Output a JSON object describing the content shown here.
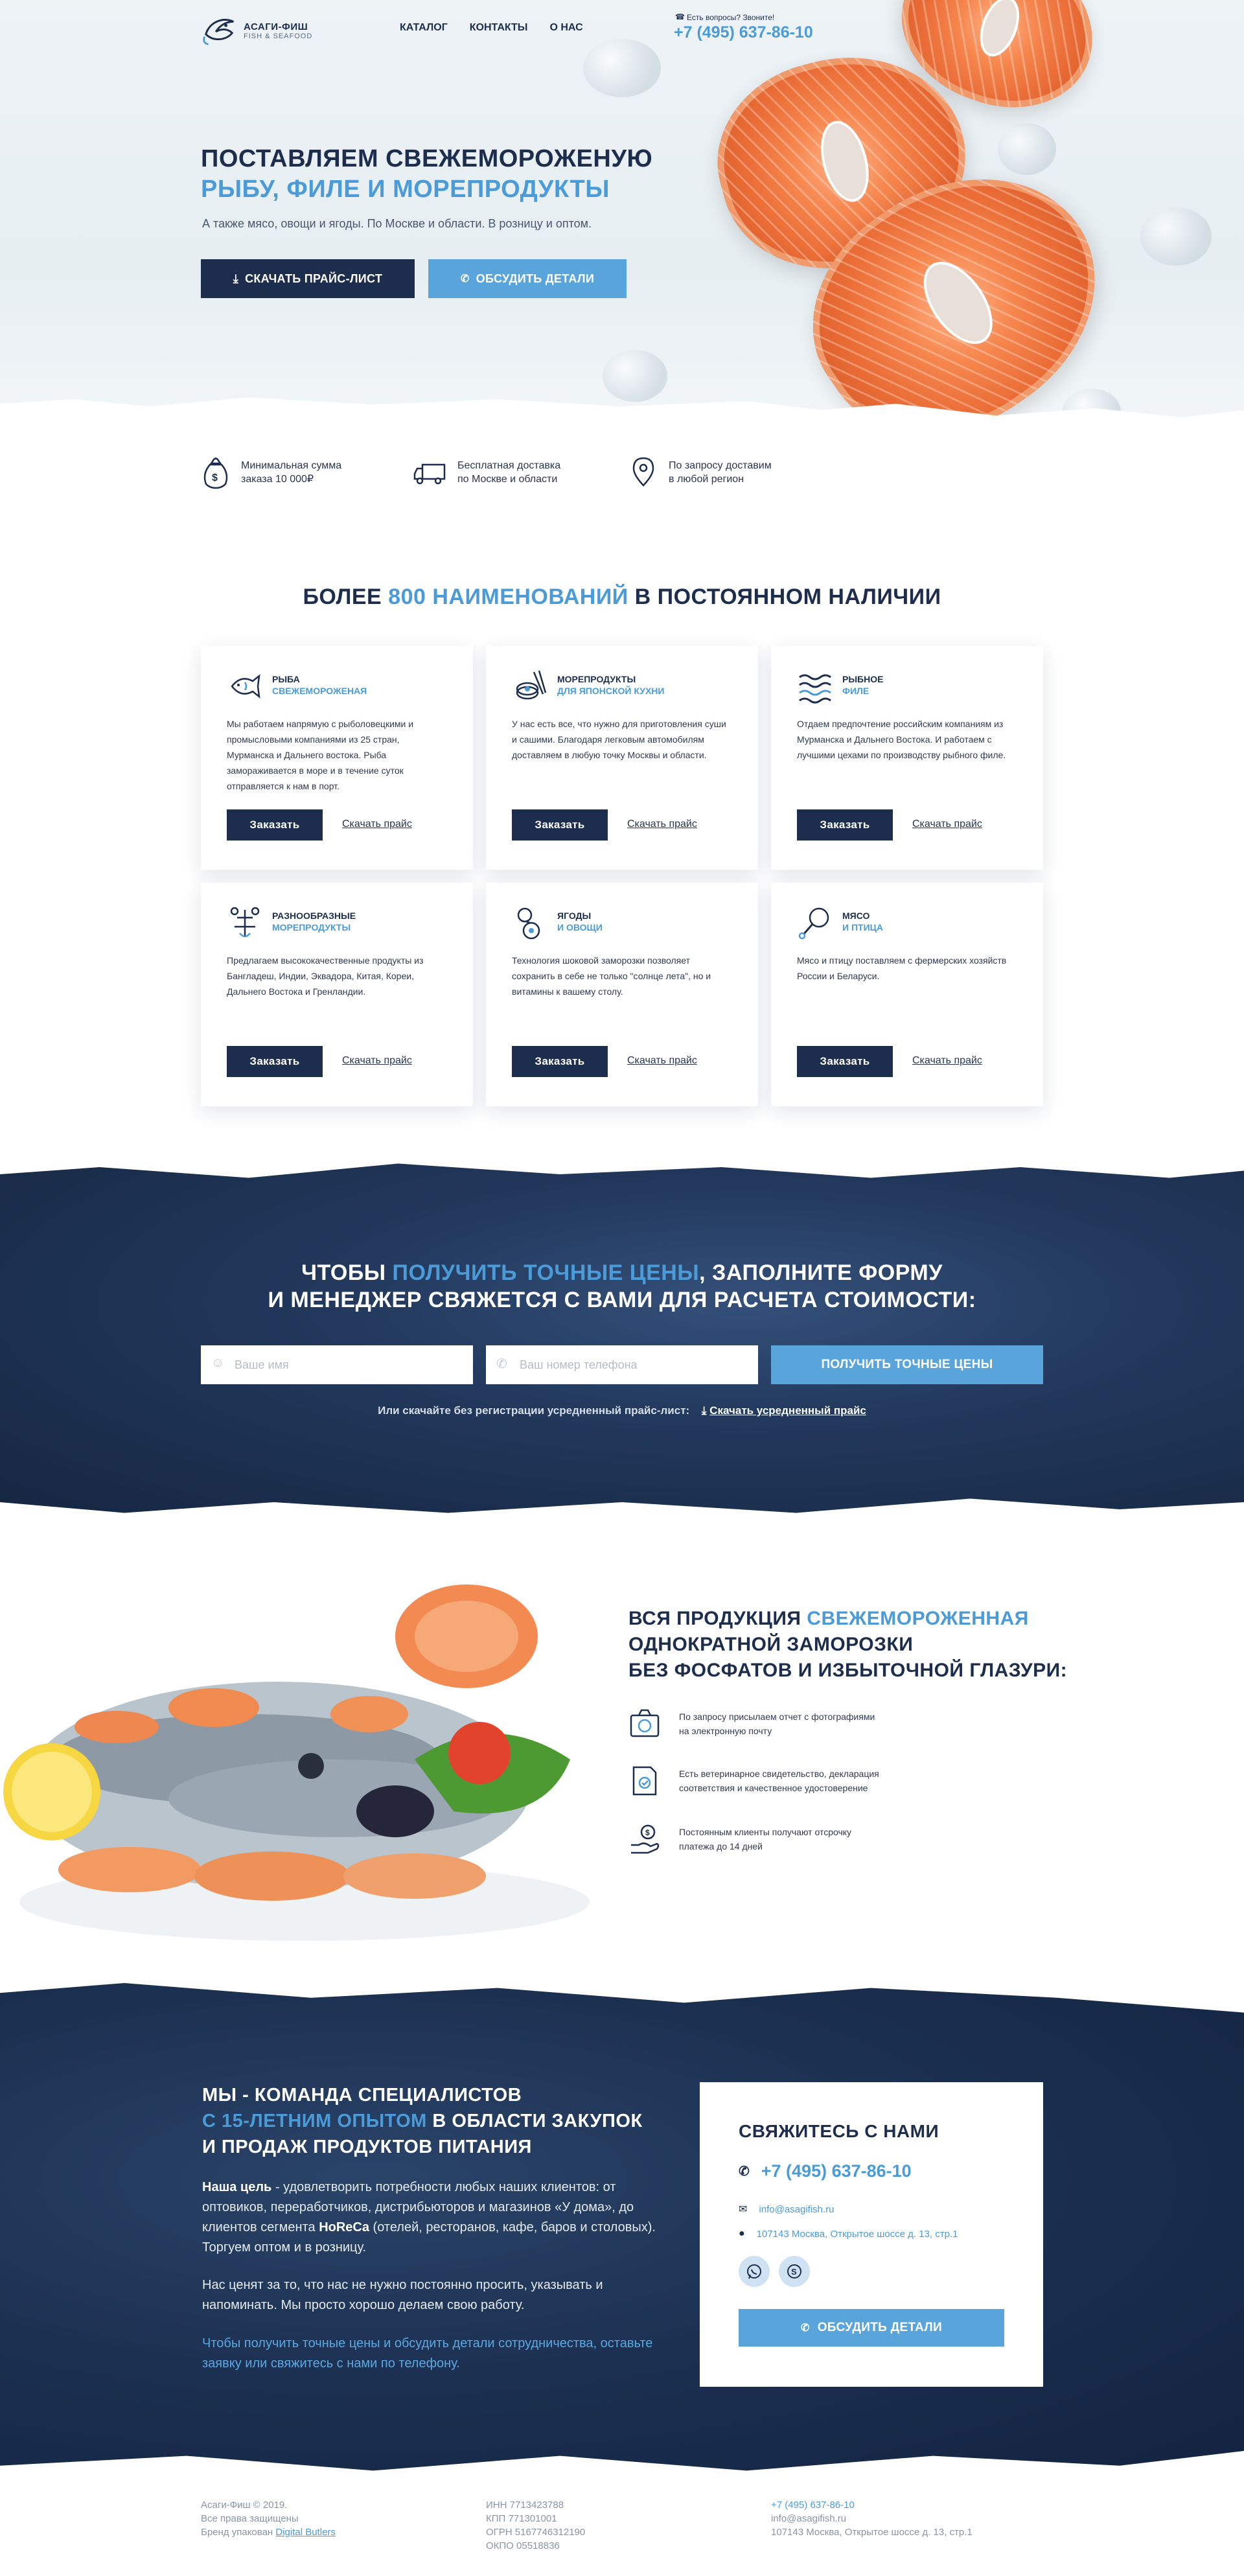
{
  "header": {
    "logo_title": "АСАГИ-ФИШ",
    "logo_sub": "FISH & SEAFOOD",
    "nav": [
      "КАТАЛОГ",
      "КОНТАКТЫ",
      "О НАС"
    ],
    "call_question": "Есть вопросы? Звоните!",
    "phone": "+7 (495) 637-86-10"
  },
  "hero": {
    "title_line1": "ПОСТАВЛЯЕМ СВЕЖЕМОРОЖЕНУЮ",
    "title_line2": "РЫБУ, ФИЛЕ И МОРЕПРОДУКТЫ",
    "subtitle": "А также мясо, овощи и ягоды. По Москве и области. В розницу и оптом.",
    "btn_price": "СКАЧАТЬ ПРАЙС-ЛИСТ",
    "btn_discuss": "ОБСУДИТЬ ДЕТАЛИ"
  },
  "features": [
    {
      "l1": "Минимальная сумма",
      "l2": "заказа 10 000₽",
      "icon": "money-bag-icon"
    },
    {
      "l1": "Бесплатная доставка",
      "l2": "по Москве и области",
      "icon": "truck-icon"
    },
    {
      "l1": "По запросу доставим",
      "l2": "в любой регион",
      "icon": "map-pin-icon"
    }
  ],
  "catalog": {
    "title_a": "БОЛЕЕ ",
    "title_b": "800 НАИМЕНОВАНИЙ",
    "title_c": " В ПОСТОЯННОМ НАЛИЧИИ",
    "order_label": "Заказать",
    "price_label": "Скачать прайс",
    "cards": [
      {
        "t1": "РЫБА",
        "t2": "СВЕЖЕМОРОЖЕНАЯ",
        "icon": "fish-icon",
        "desc": "Мы работаем напрямую с рыболовецкими и промысловыми компаниями из 25 стран, Мурманска и Дальнего востока. Рыба замораживается в море и в течение суток отправляется к нам в порт."
      },
      {
        "t1": "МОРЕПРОДУКТЫ",
        "t2": "ДЛЯ ЯПОНСКОЙ КУХНИ",
        "icon": "sushi-icon",
        "desc": "У нас есть все, что нужно для приготовления суши и сашими. Благодаря легковым автомобилям доставляем в любую точку Москвы и области."
      },
      {
        "t1": "РЫБНОЕ",
        "t2": "ФИЛЕ",
        "icon": "waves-icon",
        "desc": "Отдаем предпочтение российским компаниям из Мурманска и Дальнего Востока. И работаем с лучшими цехами по производству рыбного филе."
      },
      {
        "t1": "РАЗНООБРАЗНЫЕ",
        "t2": "МОРЕПРОДУКТЫ",
        "icon": "seafood-icon",
        "desc": "Предлагаем высококачественные продукты из Бангладеш, Индии, Эквадора, Китая, Кореи, Дальнего Востока и Гренландии."
      },
      {
        "t1": "ЯГОДЫ",
        "t2": "И ОВОЩИ",
        "icon": "berries-icon",
        "desc": "Технология шоковой заморозки позволяет сохранить в себе не только \"солнце лета\", но и витамины к вашему столу."
      },
      {
        "t1": "МЯСО",
        "t2": "И ПТИЦА",
        "icon": "meat-icon",
        "desc": "Мясо и птицу поставляем с фермерских хозяйств России и Беларуси."
      }
    ]
  },
  "form": {
    "title_a": "ЧТОБЫ ",
    "title_b": "ПОЛУЧИТЬ ТОЧНЫЕ ЦЕНЫ",
    "title_c": ", ЗАПОЛНИТЕ ФОРМУ",
    "title_line2": "И МЕНЕДЖЕР СВЯЖЕТСЯ С ВАМИ ДЛЯ РАСЧЕТА СТОИМОСТИ:",
    "name_placeholder": "Ваше имя",
    "phone_placeholder": "Ваш номер телефона",
    "submit": "ПОЛУЧИТЬ ТОЧНЫЕ ЦЕНЫ",
    "download_text": "Или скачайте без регистрации усредненный прайс-лист:",
    "download_link": "Скачать усредненный прайс"
  },
  "product": {
    "title_a": "ВСЯ ПРОДУКЦИЯ ",
    "title_b": "СВЕЖЕМОРОЖЕННАЯ",
    "title_line2": "ОДНОКРАТНОЙ ЗАМОРОЗКИ",
    "title_line3": "БЕЗ ФОСФАТОВ И ИЗБЫТОЧНОЙ ГЛАЗУРИ:",
    "items": [
      {
        "l1": "По запросу присылаем отчет с фотографиями",
        "l2": "на электронную почту",
        "icon": "camera-icon"
      },
      {
        "l1": "Есть ветеринарное свидетельство, декларация",
        "l2": "соответствия и качественное удостоверение",
        "icon": "certificate-icon"
      },
      {
        "l1": "Постоянным клиенты получают отсрочку",
        "l2": "платежа до 14 дней",
        "icon": "hand-coin-icon"
      }
    ]
  },
  "team": {
    "title_line1": "МЫ - КОМАНДА СПЕЦИАЛИСТОВ",
    "title_blue": "С 15-ЛЕТНИМ ОПЫТОМ",
    "title_line2_rest": " В ОБЛАСТИ ЗАКУПОК",
    "title_line3": "И ПРОДАЖ ПРОДУКТОВ ПИТАНИЯ",
    "goal_bold": "Наша цель",
    "goal_text": " - удовлетворить потребности любых наших клиентов: от оптовиков, переработчиков, дистрибьюторов и магазинов «У дома», до клиентов сегмента ",
    "horeca": "HoReCa",
    "goal_end": " (отелей, ресторанов, кафе, баров и столовых). Торгуем оптом и в розницу.",
    "para2": "Нас ценят за то, что нас не нужно постоянно просить, указывать и напоминать. Мы просто хорошо делаем свою работу.",
    "cta": "Чтобы получить точные цены и обсудить детали сотрудничества, оставьте заявку или свяжитесь с нами по телефону."
  },
  "contact": {
    "title": "СВЯЖИТЕСЬ С НАМИ",
    "phone": "+7 (495) 637-86-10",
    "email": "info@asagifish.ru",
    "address": "107143 Москва, Открытое шоссе д. 13, стр.1",
    "button": "ОБСУДИТЬ ДЕТАЛИ"
  },
  "footer": {
    "col1": [
      "Асаги-Фиш © 2019.",
      "Все права защищены",
      "Бренд упакован "
    ],
    "brand_link": "Digital Butlers",
    "col2": [
      "ИНН 7713423788",
      "КПП 771301001",
      "ОГРН 5167746312190",
      "ОКПО 05518836"
    ],
    "col3_phone": "+7 (495) 637-86-10",
    "col3_email": "info@asagifish.ru",
    "col3_address": "107143 Москва, Открытое шоссе д. 13, стр.1"
  },
  "colors": {
    "navy": "#1d2d4e",
    "accent": "#4a9bd8",
    "button_blue": "#5aa4dc"
  }
}
